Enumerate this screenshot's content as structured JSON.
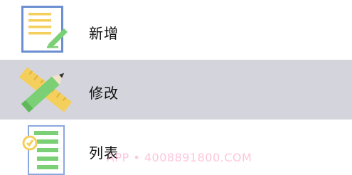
{
  "menu": {
    "items": [
      {
        "label": "新增",
        "icon": "document-edit-icon"
      },
      {
        "label": "修改",
        "icon": "pencil-ruler-icon",
        "selected": true
      },
      {
        "label": "列表",
        "icon": "list-check-icon"
      }
    ]
  },
  "watermark": {
    "text": "APP • 4008891800.COM"
  },
  "colors": {
    "selected_row": "#d4d4dc",
    "icon_blue": "#6b8fd0",
    "icon_yellow": "#f5cf5b",
    "icon_green": "#7bcf75"
  }
}
